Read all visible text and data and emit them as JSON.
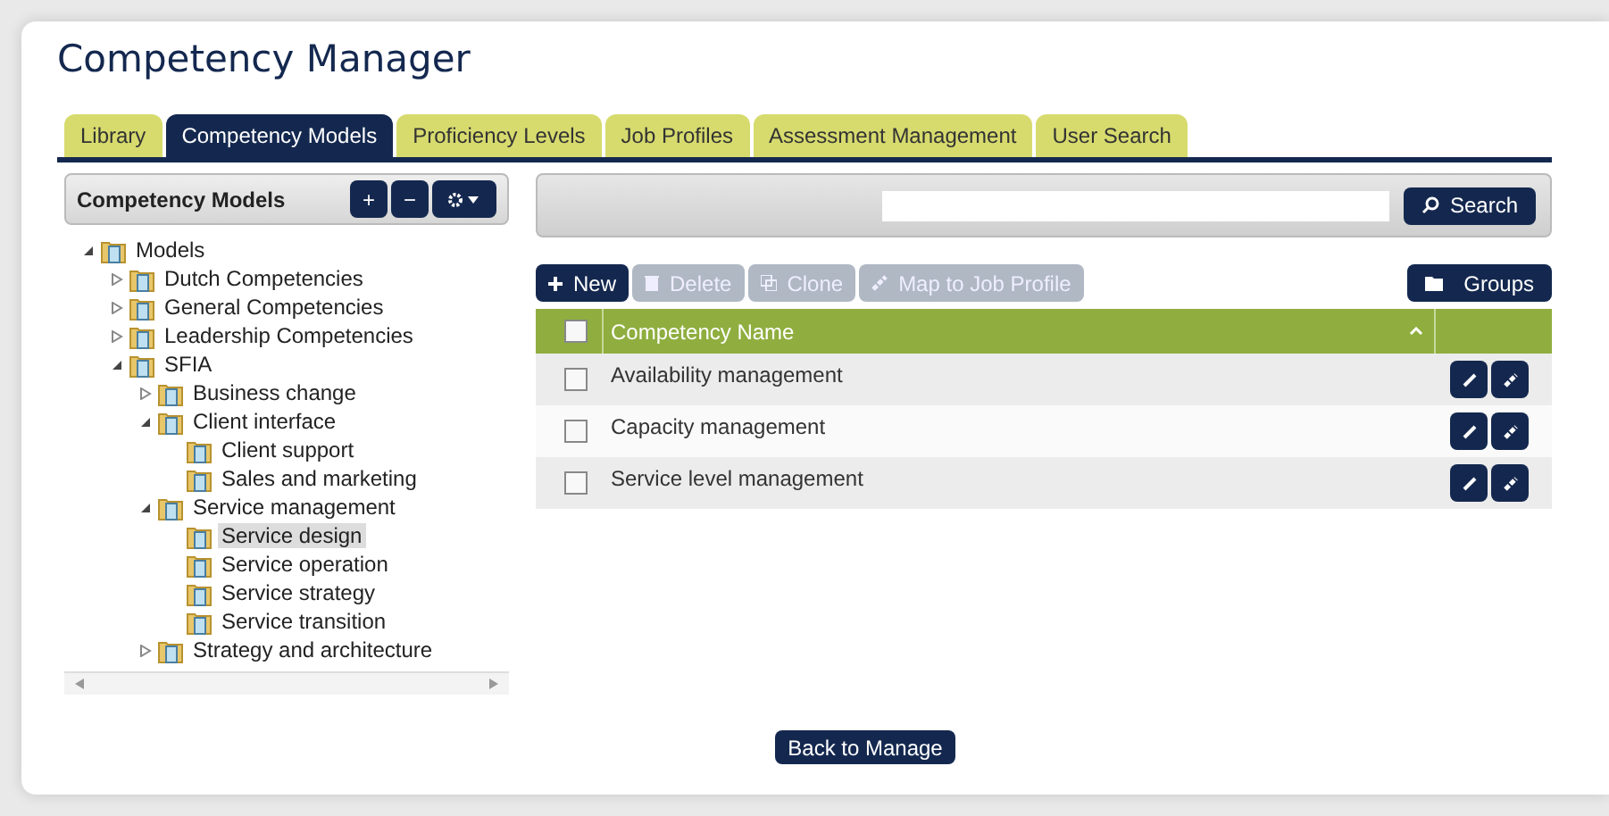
{
  "title": "Competency Manager",
  "tabs": [
    {
      "label": "Library",
      "selected": false
    },
    {
      "label": "Competency Models",
      "selected": true
    },
    {
      "label": "Proficiency Levels",
      "selected": false
    },
    {
      "label": "Job Profiles",
      "selected": false
    },
    {
      "label": "Assessment Management",
      "selected": false
    },
    {
      "label": "User Search",
      "selected": false
    }
  ],
  "sidebar": {
    "title": "Competency Models",
    "buttons": [
      "+",
      "−"
    ],
    "tree": [
      {
        "label": "Models",
        "expanded": true,
        "selected": false,
        "children": [
          {
            "label": "Dutch Competencies",
            "expanded": false,
            "selected": false
          },
          {
            "label": "General Competencies",
            "expanded": false,
            "selected": false
          },
          {
            "label": "Leadership Competencies",
            "expanded": false,
            "selected": false
          },
          {
            "label": "SFIA",
            "expanded": true,
            "selected": false,
            "children": [
              {
                "label": "Business change",
                "expanded": false,
                "selected": false
              },
              {
                "label": "Client interface",
                "expanded": true,
                "selected": false,
                "children": [
                  {
                    "label": "Client support",
                    "selected": false
                  },
                  {
                    "label": "Sales and marketing",
                    "selected": false
                  }
                ]
              },
              {
                "label": "Service management",
                "expanded": true,
                "selected": false,
                "children": [
                  {
                    "label": "Service design",
                    "selected": true
                  },
                  {
                    "label": "Service operation",
                    "selected": false
                  },
                  {
                    "label": "Service strategy",
                    "selected": false
                  },
                  {
                    "label": "Service transition",
                    "selected": false
                  }
                ]
              },
              {
                "label": "Strategy and architecture",
                "expanded": false,
                "selected": false
              }
            ]
          }
        ]
      }
    ]
  },
  "search": {
    "button": "Search"
  },
  "toolbar": [
    {
      "label": "New",
      "kind": "new",
      "disabled": false
    },
    {
      "label": "Delete",
      "kind": "delete",
      "disabled": true
    },
    {
      "label": "Clone",
      "kind": "clone",
      "disabled": true
    },
    {
      "label": "Map to Job Profile",
      "kind": "map",
      "disabled": true
    }
  ],
  "groups_button": "Groups",
  "table": {
    "columns": [
      "Competency Name"
    ],
    "all_checked": false,
    "rows": [
      {
        "name": "Availability management",
        "checked": false
      },
      {
        "name": "Capacity management",
        "checked": false
      },
      {
        "name": "Service level management",
        "checked": false
      }
    ]
  },
  "back_button": "Back to Manage"
}
